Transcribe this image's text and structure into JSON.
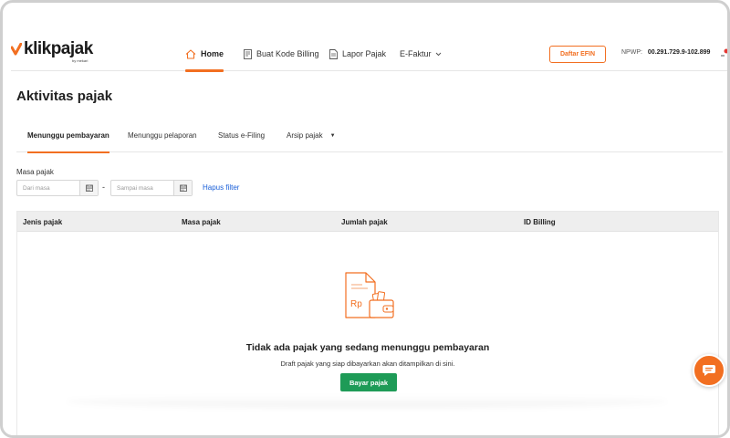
{
  "brand": {
    "name": "klikpajak",
    "tagline": "by mekari",
    "accent": "#f26f21"
  },
  "nav": {
    "items": [
      {
        "label": "Home",
        "icon": "home-icon",
        "active": true
      },
      {
        "label": "Buat Kode Billing",
        "icon": "document-icon",
        "active": false
      },
      {
        "label": "Lapor Pajak",
        "icon": "report-icon",
        "active": false
      },
      {
        "label": "E-Faktur",
        "icon": "chevron-down-icon",
        "active": false
      }
    ],
    "efin_button": "Daftar EFIN",
    "npwp_label": "NPWP:",
    "npwp_value": "00.291.729.9-102.899"
  },
  "page": {
    "title": "Aktivitas pajak"
  },
  "tabs": [
    {
      "label": "Menunggu pembayaran",
      "active": true
    },
    {
      "label": "Menunggu pelaporan",
      "active": false
    },
    {
      "label": "Status e-Filing",
      "active": false
    },
    {
      "label": "Arsip pajak",
      "active": false
    }
  ],
  "filter": {
    "label": "Masa pajak",
    "from_placeholder": "Dari masa",
    "separator": "-",
    "to_placeholder": "Sampai masa",
    "clear_link": "Hapus filter"
  },
  "table": {
    "columns": [
      "Jenis pajak",
      "Masa pajak",
      "Jumlah pajak",
      "ID Billing"
    ],
    "empty": {
      "title": "Tidak ada pajak yang sedang menunggu pembayaran",
      "subtitle": "Draft pajak yang siap dibayarkan akan ditampilkan di sini.",
      "action": "Bayar pajak"
    }
  },
  "colors": {
    "accent": "#f26f21",
    "success": "#1e9b57",
    "link": "#1a5fd8"
  }
}
